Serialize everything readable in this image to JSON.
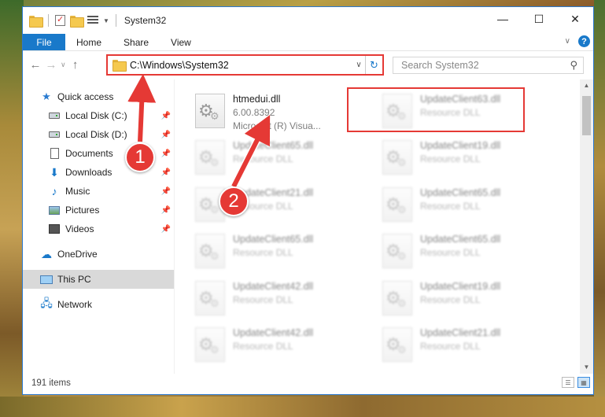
{
  "window": {
    "title": "System32",
    "controls": [
      "—",
      "☐",
      "✕"
    ]
  },
  "ribbon": {
    "tabs": [
      "File",
      "Home",
      "Share",
      "View"
    ],
    "help": "?"
  },
  "navbar": {
    "address": "C:\\Windows\\System32",
    "search_placeholder": "Search System32"
  },
  "sidebar": {
    "items": [
      {
        "label": "Quick access",
        "icon": "star-icon"
      },
      {
        "label": "Local Disk (C:)",
        "icon": "drive-icon"
      },
      {
        "label": "Local Disk (D:)",
        "icon": "drive-icon"
      },
      {
        "label": "Documents",
        "icon": "documents-icon"
      },
      {
        "label": "Downloads",
        "icon": "downloads-icon"
      },
      {
        "label": "Music",
        "icon": "music-icon"
      },
      {
        "label": "Pictures",
        "icon": "pictures-icon"
      },
      {
        "label": "Videos",
        "icon": "videos-icon"
      },
      {
        "label": "OneDrive",
        "icon": "onedrive-icon"
      },
      {
        "label": "This PC",
        "icon": "this-pc-icon"
      },
      {
        "label": "Network",
        "icon": "network-icon"
      }
    ]
  },
  "files": [
    {
      "name": "htmedui.dll",
      "line2": "6.00.8392",
      "line3": "Microsoft (R) Visua..."
    },
    {
      "name": "UpdateClient63.dll",
      "line2": "Resource DLL"
    },
    {
      "name": "UpdateClient65.dll",
      "line2": "Resource DLL"
    },
    {
      "name": "UpdateClient19.dll",
      "line2": "Resource DLL"
    },
    {
      "name": "UpdateClient21.dll",
      "line2": "Resource DLL"
    },
    {
      "name": "UpdateClient65.dll",
      "line2": "Resource DLL"
    },
    {
      "name": "UpdateClient65.dll",
      "line2": "Resource DLL"
    },
    {
      "name": "UpdateClient65.dll",
      "line2": "Resource DLL"
    },
    {
      "name": "UpdateClient42.dll",
      "line2": "Resource DLL"
    },
    {
      "name": "UpdateClient19.dll",
      "line2": "Resource DLL"
    },
    {
      "name": "UpdateClient42.dll",
      "line2": "Resource DLL"
    },
    {
      "name": "UpdateClient21.dll",
      "line2": "Resource DLL"
    }
  ],
  "status": {
    "item_count": "191 items"
  },
  "annotations": {
    "step1": "1",
    "step2": "2",
    "color": "#e53935"
  }
}
